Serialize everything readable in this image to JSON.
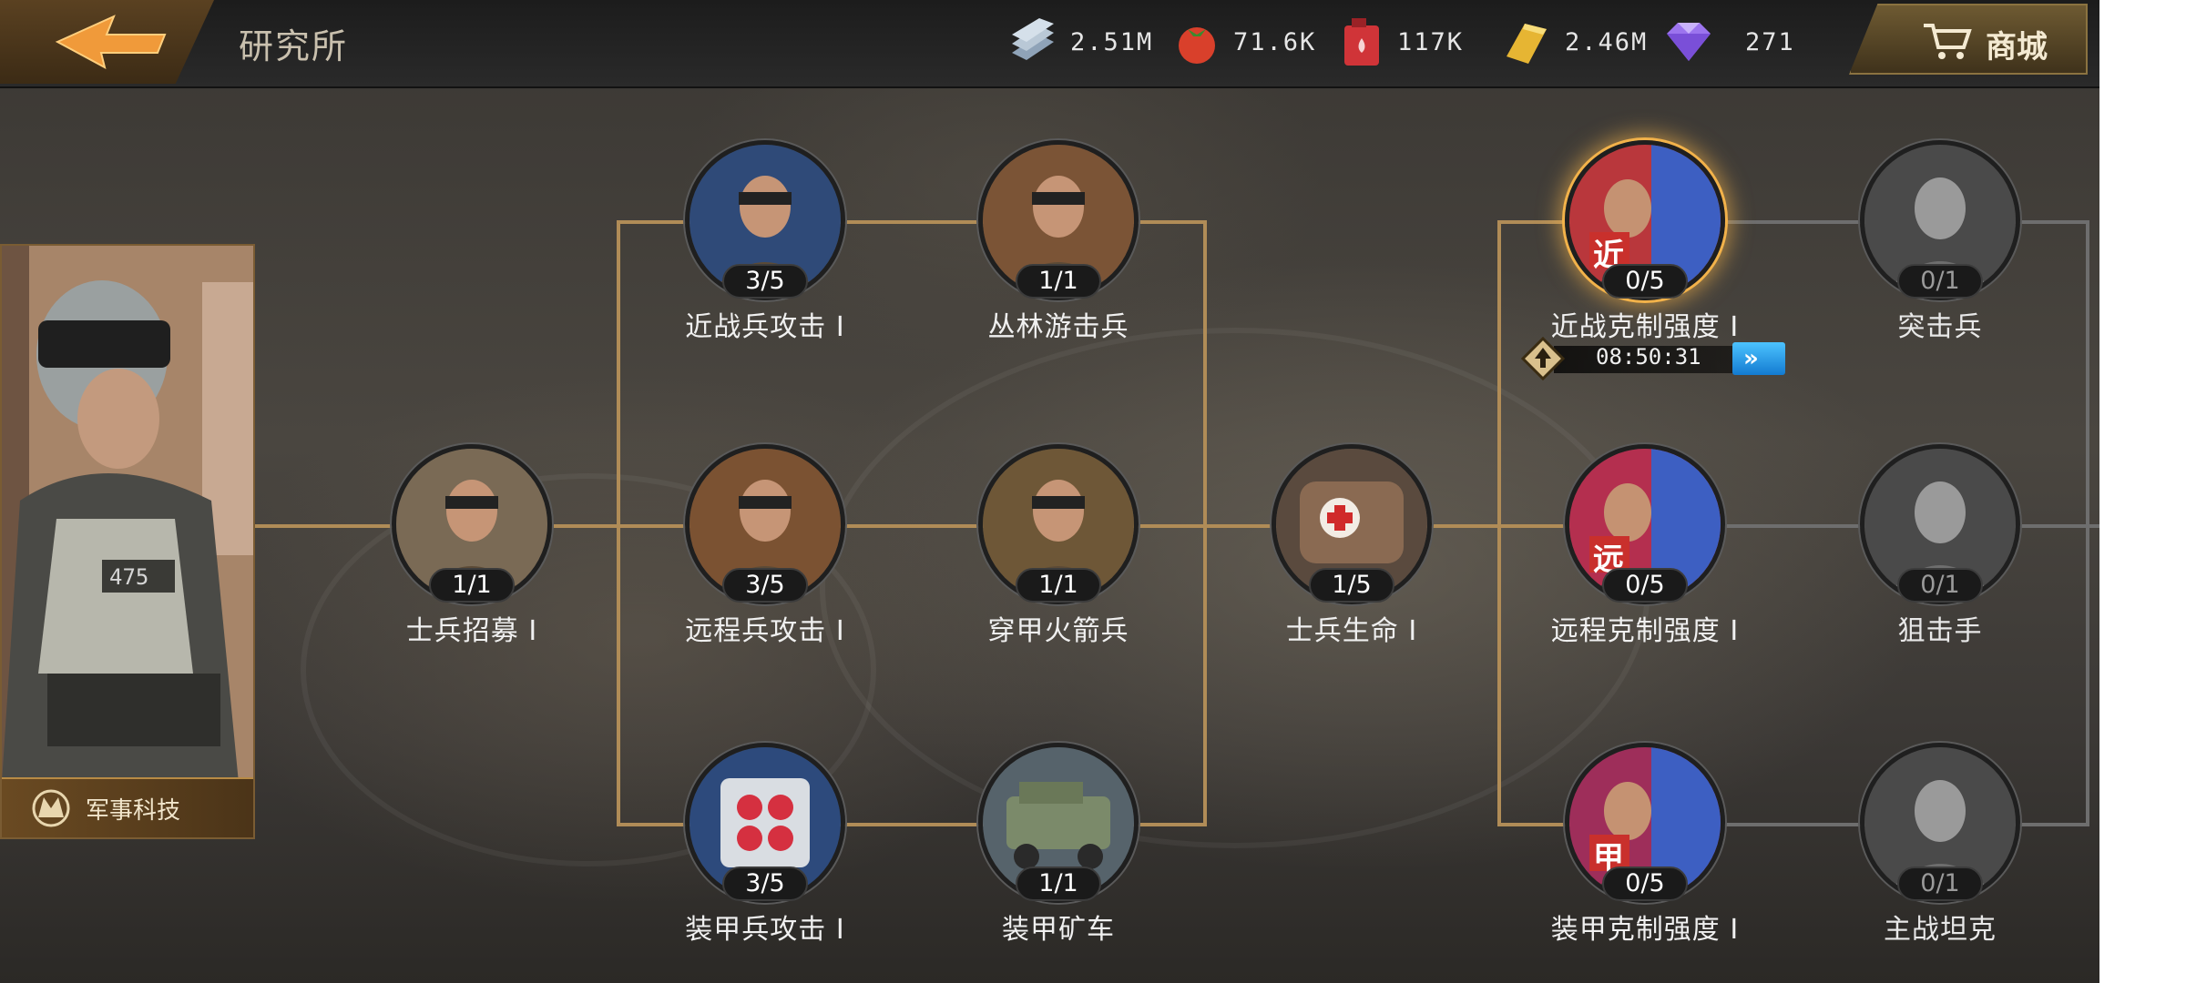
{
  "header": {
    "title": "研究所",
    "shop_label": "商城"
  },
  "resources": [
    {
      "name": "steel",
      "icon": "steel-bars-icon",
      "value": "2.51M",
      "color": "#9fb3c8"
    },
    {
      "name": "food",
      "icon": "tomato-icon",
      "value": "71.6K",
      "color": "#e0472e"
    },
    {
      "name": "oil",
      "icon": "oil-canister-icon",
      "value": "117K",
      "color": "#d8363a"
    },
    {
      "name": "gold",
      "icon": "gold-bar-icon",
      "value": "2.46M",
      "color": "#e8b93a"
    },
    {
      "name": "diamond",
      "icon": "diamond-icon",
      "value": "271",
      "color": "#a27cf0"
    }
  ],
  "side_panel": {
    "label": "军事科技"
  },
  "timer": {
    "text": "08:50:31"
  },
  "nodes": [
    {
      "id": "recruit",
      "name": "士兵招募 I",
      "progress": "1/1",
      "state": "complete",
      "icon": "soldiers-squad-icon",
      "color": "#7a6a55"
    },
    {
      "id": "melee-atk",
      "name": "近战兵攻击 I",
      "progress": "3/5",
      "state": "active",
      "icon": "melee-soldier-icon",
      "color": "#2f4a78"
    },
    {
      "id": "ranged-atk",
      "name": "远程兵攻击 I",
      "progress": "3/5",
      "state": "active",
      "icon": "rifleman-icon",
      "color": "#7b5232"
    },
    {
      "id": "armor-atk",
      "name": "装甲兵攻击 I",
      "progress": "3/5",
      "state": "active",
      "icon": "rocket-pod-icon",
      "color": "#2d4a7c"
    },
    {
      "id": "jungle",
      "name": "丛林游击兵",
      "progress": "1/1",
      "state": "complete",
      "icon": "jungle-ranger-icon",
      "color": "#7b5436"
    },
    {
      "id": "rocket",
      "name": "穿甲火箭兵",
      "progress": "1/1",
      "state": "complete",
      "icon": "rocket-trooper-icon",
      "color": "#6e5737"
    },
    {
      "id": "mine-truck",
      "name": "装甲矿车",
      "progress": "1/1",
      "state": "complete",
      "icon": "armored-truck-icon",
      "color": "#56636b"
    },
    {
      "id": "hp",
      "name": "士兵生命 I",
      "progress": "1/5",
      "state": "active",
      "icon": "medkit-icon",
      "color": "#8a6a52"
    },
    {
      "id": "melee-counter",
      "name": "近战克制强度 I",
      "progress": "0/5",
      "state": "researching",
      "icon": "melee-counter-icon",
      "color": "#b9373c"
    },
    {
      "id": "ranged-counter",
      "name": "远程克制强度 I",
      "progress": "0/5",
      "state": "available",
      "icon": "ranged-counter-icon",
      "color": "#b42f4f"
    },
    {
      "id": "armor-counter",
      "name": "装甲克制强度 I",
      "progress": "0/5",
      "state": "available",
      "icon": "armor-counter-icon",
      "color": "#9e2e5a"
    },
    {
      "id": "assault",
      "name": "突击兵",
      "progress": "0/1",
      "state": "locked",
      "icon": "assault-trooper-icon",
      "color": "#7a7a7a"
    },
    {
      "id": "sniper",
      "name": "狙击手",
      "progress": "0/1",
      "state": "locked",
      "icon": "sniper-icon",
      "color": "#7a7a7a"
    },
    {
      "id": "tank",
      "name": "主战坦克",
      "progress": "0/1",
      "state": "locked",
      "icon": "battle-tank-icon",
      "color": "#7a7a7a"
    }
  ],
  "counter_badges": {
    "melee": "近",
    "ranged": "远",
    "armor": "甲"
  }
}
